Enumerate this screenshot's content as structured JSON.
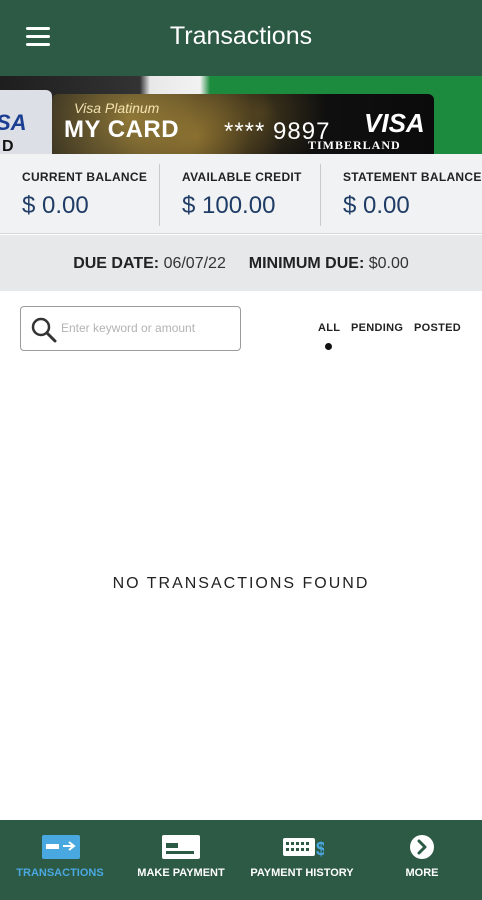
{
  "header": {
    "title": "Transactions",
    "menu_icon": "hamburger-menu-icon"
  },
  "card": {
    "left_card_brand": "SA",
    "left_card_sub": "D",
    "tier": "Visa Platinum",
    "name": "MY CARD",
    "number": "**** 9897",
    "network": "VISA",
    "bank": "TIMBERLAND"
  },
  "balances": [
    {
      "label": "CURRENT BALANCE",
      "value": "$ 0.00"
    },
    {
      "label": "AVAILABLE CREDIT",
      "value": "$ 100.00"
    },
    {
      "label": "STATEMENT BALANCE",
      "value": "$ 0.00"
    }
  ],
  "due": {
    "due_date_label": "DUE DATE:",
    "due_date_value": "06/07/22",
    "minimum_due_label": "MINIMUM DUE:",
    "minimum_due_value": "$0.00"
  },
  "search": {
    "placeholder": "Enter keyword or amount",
    "value": ""
  },
  "filters": {
    "items": [
      "ALL",
      "PENDING",
      "POSTED"
    ],
    "selected": "ALL"
  },
  "empty_message": "NO TRANSACTIONS FOUND",
  "bottom_nav": {
    "items": [
      {
        "label": "TRANSACTIONS",
        "icon": "transactions-card-icon",
        "active": true
      },
      {
        "label": "MAKE PAYMENT",
        "icon": "payment-card-icon",
        "active": false
      },
      {
        "label": "PAYMENT HISTORY",
        "icon": "payment-history-icon",
        "active": false
      },
      {
        "label": "MORE",
        "icon": "chevron-right-circle-icon",
        "active": false
      }
    ]
  },
  "colors": {
    "brand_green": "#2d5a45",
    "balance_blue": "#1f3c66",
    "active_nav": "#4aa8e0"
  }
}
